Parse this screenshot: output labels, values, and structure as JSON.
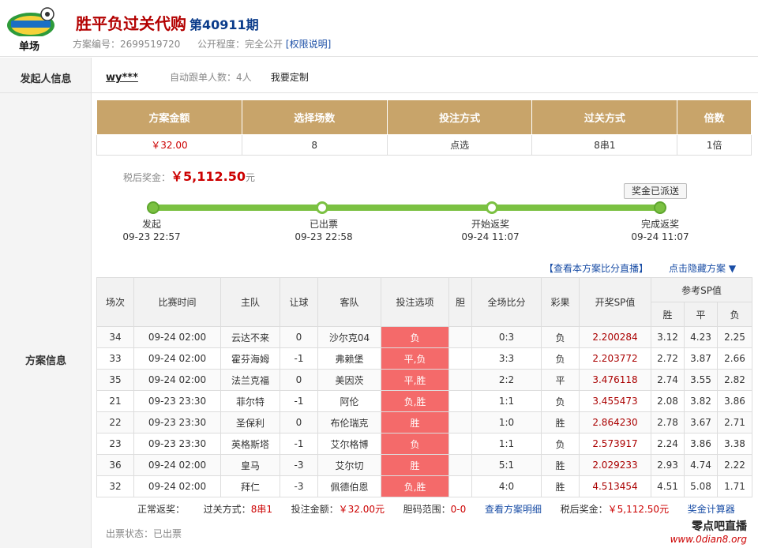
{
  "header": {
    "title": "胜平负过关代购",
    "issue": "第40911期",
    "plan_no_label": "方案编号：",
    "plan_no": "2699519720",
    "public_label": "公开程度：",
    "public_value": "完全公开",
    "permission_link": "[权限说明]",
    "logo_text": "单场"
  },
  "initiator": {
    "label": "发起人信息",
    "user": "wy***",
    "follow": "自动跟单人数：4人",
    "custom": "我要定制"
  },
  "summary": {
    "headers": [
      "方案金额",
      "选择场数",
      "投注方式",
      "过关方式",
      "倍数"
    ],
    "values": [
      "￥32.00",
      "8",
      "点选",
      "8串1",
      "1倍"
    ]
  },
  "prize": {
    "label": "税后奖金：",
    "amount": "￥5,112.50",
    "unit": "元",
    "dispatch_button": "奖金已派送"
  },
  "progress": {
    "steps": [
      {
        "label": "发起",
        "time": "09-23 22:57"
      },
      {
        "label": "已出票",
        "time": "09-23 22:58"
      },
      {
        "label": "开始返奖",
        "time": "09-24 11:07"
      },
      {
        "label": "完成返奖",
        "time": "09-24 11:07"
      }
    ]
  },
  "links": {
    "live": "【查看本方案比分直播】",
    "hide": "点击隐藏方案 ▼"
  },
  "plan_label": "方案信息",
  "detail": {
    "headers": [
      "场次",
      "比赛时间",
      "主队",
      "让球",
      "客队",
      "投注选项",
      "胆",
      "全场比分",
      "彩果",
      "开奖SP值"
    ],
    "sp_group": "参考SP值",
    "sp_sub": [
      "胜",
      "平",
      "负"
    ],
    "rows": [
      [
        "34",
        "09-24 02:00",
        "云达不来",
        "0",
        "沙尔克04",
        "负",
        "",
        "0:3",
        "负",
        "2.200284",
        "3.12",
        "4.23",
        "2.25"
      ],
      [
        "33",
        "09-24 02:00",
        "霍芬海姆",
        "-1",
        "弗赖堡",
        "平,负",
        "",
        "3:3",
        "负",
        "2.203772",
        "2.72",
        "3.87",
        "2.66"
      ],
      [
        "35",
        "09-24 02:00",
        "法兰克福",
        "0",
        "美因茨",
        "平,胜",
        "",
        "2:2",
        "平",
        "3.476118",
        "2.74",
        "3.55",
        "2.82"
      ],
      [
        "21",
        "09-23 23:30",
        "菲尔特",
        "-1",
        "阿伦",
        "负,胜",
        "",
        "1:1",
        "负",
        "3.455473",
        "2.08",
        "3.82",
        "3.86"
      ],
      [
        "22",
        "09-23 23:30",
        "圣保利",
        "0",
        "布伦瑞克",
        "胜",
        "",
        "1:0",
        "胜",
        "2.864230",
        "2.78",
        "3.67",
        "2.71"
      ],
      [
        "23",
        "09-23 23:30",
        "英格斯塔",
        "-1",
        "艾尔格博",
        "负",
        "",
        "1:1",
        "负",
        "2.573917",
        "2.24",
        "3.86",
        "3.38"
      ],
      [
        "36",
        "09-24 02:00",
        "皇马",
        "-3",
        "艾尔切",
        "胜",
        "",
        "5:1",
        "胜",
        "2.029233",
        "2.93",
        "4.74",
        "2.22"
      ],
      [
        "32",
        "09-24 02:00",
        "拜仁",
        "-3",
        "佩德伯恩",
        "负,胜",
        "",
        "4:0",
        "胜",
        "4.513454",
        "4.51",
        "5.08",
        "1.71"
      ]
    ]
  },
  "footer": {
    "normal": "正常返奖：",
    "pass_label": "过关方式：",
    "pass_value": "8串1",
    "bet_label": "投注金额：",
    "bet_value": "￥32.00元",
    "range_label": "胆码范围：",
    "range_value": "0-0",
    "detail_link": "查看方案明细",
    "after_tax_label": "税后奖金：",
    "after_tax_value": "￥5,112.50元",
    "calc_link": "奖金计算器"
  },
  "ticket_status": "出票状态：已出票",
  "watermark": {
    "cn": "零点吧直播",
    "url": "www.0dian8.org"
  },
  "colors": {
    "accent_gold": "#c8a46a",
    "progress_green": "#7bc142",
    "pick_red": "#f46a6a",
    "title_red": "#b30000"
  }
}
